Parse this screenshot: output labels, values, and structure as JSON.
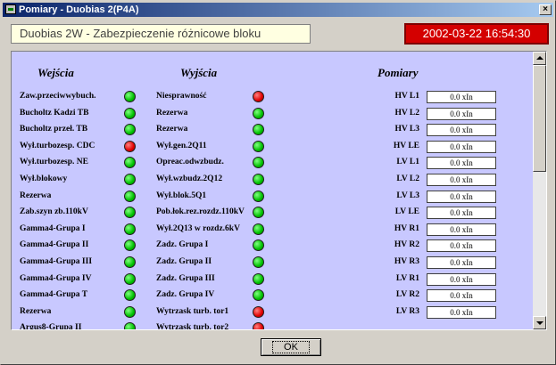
{
  "window": {
    "title": "Pomiary - Duobias 2(P4A)",
    "close_label": "×"
  },
  "header": {
    "device_label": "Duobias 2W - Zabezpieczenie różnicowe bloku",
    "datetime": "2002-03-22 16:54:30"
  },
  "columns": {
    "inputs": "Wejścia",
    "outputs": "Wyjścia",
    "measurements": "Pomiary"
  },
  "inputs": [
    {
      "label": "Zaw.przeciwwybuch.",
      "status": "green"
    },
    {
      "label": "Bucholtz Kadzi TB",
      "status": "green"
    },
    {
      "label": "Bucholtz przeł. TB",
      "status": "green"
    },
    {
      "label": "Wył.turbozesp. CDC",
      "status": "red"
    },
    {
      "label": "Wył.turbozesp. NE",
      "status": "green"
    },
    {
      "label": "Wył.blokowy",
      "status": "green"
    },
    {
      "label": "Rezerwa",
      "status": "green"
    },
    {
      "label": "Zab.szyn zb.110kV",
      "status": "green"
    },
    {
      "label": "Gamma4-Grupa I",
      "status": "green"
    },
    {
      "label": "Gamma4-Grupa II",
      "status": "green"
    },
    {
      "label": "Gamma4-Grupa III",
      "status": "green"
    },
    {
      "label": "Gamma4-Grupa IV",
      "status": "green"
    },
    {
      "label": "Gamma4-Grupa T",
      "status": "green"
    },
    {
      "label": "Rezerwa",
      "status": "green"
    },
    {
      "label": "Argus8-Grupa II",
      "status": "green"
    }
  ],
  "outputs": [
    {
      "label": "Niesprawność",
      "status": "red"
    },
    {
      "label": "Rezerwa",
      "status": "green"
    },
    {
      "label": "Rezerwa",
      "status": "green"
    },
    {
      "label": "Wył.gen.2Q11",
      "status": "green"
    },
    {
      "label": "Opreac.odwzbudz.",
      "status": "green"
    },
    {
      "label": "Wył.wzbudz.2Q12",
      "status": "green"
    },
    {
      "label": "Wył.blok.5Q1",
      "status": "green"
    },
    {
      "label": "Pob.łok.rez.rozdz.110kV",
      "status": "green"
    },
    {
      "label": "Wył.2Q13 w rozdz.6kV",
      "status": "green"
    },
    {
      "label": "Zadz. Grupa I",
      "status": "green"
    },
    {
      "label": "Zadz. Grupa II",
      "status": "green"
    },
    {
      "label": "Zadz. Grupa III",
      "status": "green"
    },
    {
      "label": "Zadz. Grupa IV",
      "status": "green"
    },
    {
      "label": "Wytrzask turb. tor1",
      "status": "red"
    },
    {
      "label": "Wytrzask turb. tor2",
      "status": "red"
    }
  ],
  "measurements": [
    {
      "label": "HV L1",
      "value": "0.0 xIn"
    },
    {
      "label": "HV L2",
      "value": "0.0 xIn"
    },
    {
      "label": "HV L3",
      "value": "0.0 xIn"
    },
    {
      "label": "HV LE",
      "value": "0.0 xIn"
    },
    {
      "label": "LV L1",
      "value": "0.0 xIn"
    },
    {
      "label": "LV L2",
      "value": "0.0 xIn"
    },
    {
      "label": "LV L3",
      "value": "0.0 xIn"
    },
    {
      "label": "LV LE",
      "value": "0.0 xIn"
    },
    {
      "label": "HV R1",
      "value": "0.0 xIn"
    },
    {
      "label": "HV R2",
      "value": "0.0 xIn"
    },
    {
      "label": "HV R3",
      "value": "0.0 xIn"
    },
    {
      "label": "LV R1",
      "value": "0.0 xIn"
    },
    {
      "label": "LV R2",
      "value": "0.0 xIn"
    },
    {
      "label": "LV R3",
      "value": "0.0 xIn"
    }
  ],
  "footer": {
    "ok_label": "OK"
  },
  "colors": {
    "led_on": "#00c000",
    "led_alarm": "#e00000",
    "panel_bg": "#c8c8ff",
    "clock_bg": "#d40000",
    "label_bg": "#ffffe1"
  }
}
